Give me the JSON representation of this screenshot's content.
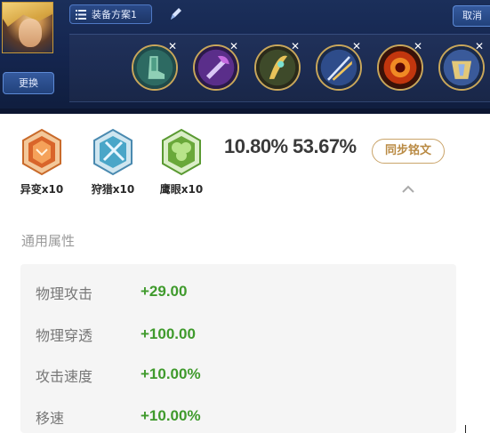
{
  "header": {
    "plan_label": "装备方案1",
    "cancel_label": "取消",
    "swap_label": "更换"
  },
  "equipment_slots": [
    {
      "icon": "boots-icon",
      "remove_glyph": "✕"
    },
    {
      "icon": "axe-icon",
      "remove_glyph": "✕"
    },
    {
      "icon": "golden-bow-icon",
      "remove_glyph": "✕"
    },
    {
      "icon": "blades-icon",
      "remove_glyph": "✕"
    },
    {
      "icon": "fire-eye-icon",
      "remove_glyph": "✕"
    },
    {
      "icon": "armor-icon",
      "remove_glyph": "✕"
    }
  ],
  "runes": [
    {
      "label": "异变x10",
      "color": "#d9652a"
    },
    {
      "label": "狩猎x10",
      "color": "#4aa6c8"
    },
    {
      "label": "鹰眼x10",
      "color": "#6aa83a"
    }
  ],
  "stats": {
    "pct_1": "10.80%",
    "pct_2": "53.67%"
  },
  "sync_button_label": "同步铭文",
  "section_title": "通用属性",
  "attributes": [
    {
      "name": "物理攻击",
      "value": "+29.00"
    },
    {
      "name": "物理穿透",
      "value": "+100.00"
    },
    {
      "name": "攻击速度",
      "value": "+10.00%"
    },
    {
      "name": "移速",
      "value": "+10.00%"
    }
  ],
  "colors": {
    "accent_gold": "#caa46a",
    "value_green": "#3f9a2c",
    "panel_navy": "#152650"
  }
}
